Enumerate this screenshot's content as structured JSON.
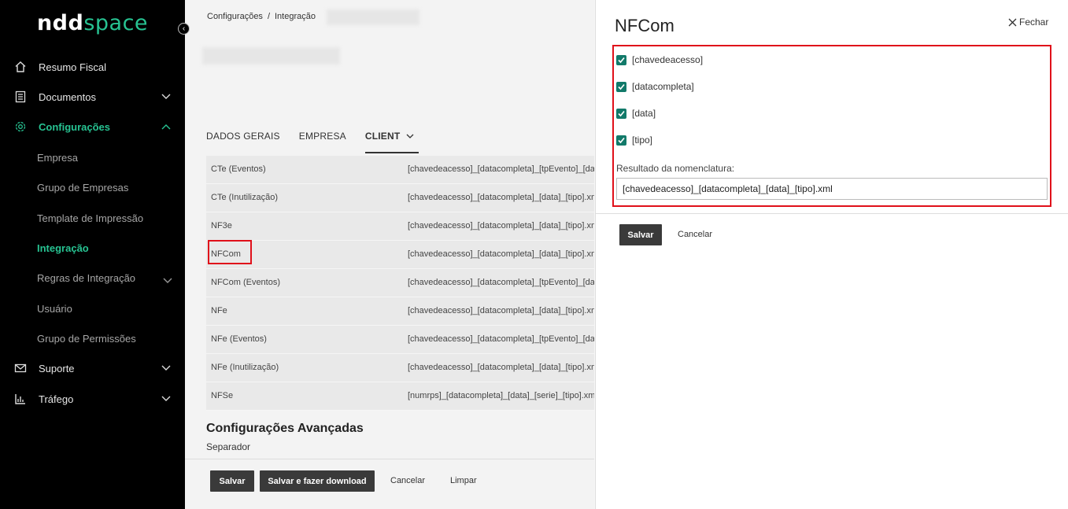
{
  "sidebar": {
    "logo_bold": "ndd",
    "logo_thin": "space",
    "items": [
      {
        "label": "Resumo Fiscal"
      },
      {
        "label": "Documentos"
      },
      {
        "label": "Configurações"
      },
      {
        "label": "Suporte"
      },
      {
        "label": "Tráfego"
      }
    ],
    "sub_items": [
      {
        "label": "Empresa"
      },
      {
        "label": "Grupo de Empresas"
      },
      {
        "label": "Template de Impressão"
      },
      {
        "label": "Integração"
      },
      {
        "label": "Regras de Integração"
      },
      {
        "label": "Usuário"
      },
      {
        "label": "Grupo de Permissões"
      }
    ]
  },
  "main": {
    "breadcrumb": {
      "first": "Configurações",
      "sep": "/",
      "second": "Integração"
    },
    "tabs": [
      {
        "label": "DADOS GERAIS"
      },
      {
        "label": "EMPRESA"
      },
      {
        "label": "CLIENT"
      }
    ],
    "rows": [
      {
        "name": "CTe (Eventos)",
        "pattern": "[chavedeacesso]_[datacompleta]_[tpEvento]_[dat"
      },
      {
        "name": "CTe (Inutilização)",
        "pattern": "[chavedeacesso]_[datacompleta]_[data]_[tipo].xm"
      },
      {
        "name": "NF3e",
        "pattern": "[chavedeacesso]_[datacompleta]_[data]_[tipo].xm"
      },
      {
        "name": "NFCom",
        "pattern": "[chavedeacesso]_[datacompleta]_[data]_[tipo].xm"
      },
      {
        "name": "NFCom (Eventos)",
        "pattern": "[chavedeacesso]_[datacompleta]_[tpEvento]_[dat"
      },
      {
        "name": "NFe",
        "pattern": "[chavedeacesso]_[datacompleta]_[data]_[tipo].xm"
      },
      {
        "name": "NFe (Eventos)",
        "pattern": "[chavedeacesso]_[datacompleta]_[tpEvento]_[dat"
      },
      {
        "name": "NFe (Inutilização)",
        "pattern": "[chavedeacesso]_[datacompleta]_[data]_[tipo].xm"
      },
      {
        "name": "NFSe",
        "pattern": "[numrps]_[datacompleta]_[data]_[serie]_[tipo].xm"
      }
    ],
    "advanced_title": "Configurações Avançadas",
    "advanced_sub": "Separador",
    "footer": {
      "save": "Salvar",
      "save_download": "Salvar e fazer download",
      "cancel": "Cancelar",
      "clear": "Limpar"
    }
  },
  "panel": {
    "title": "NFCom",
    "close_label": "Fechar",
    "checks": [
      {
        "label": "[chavedeacesso]",
        "checked": true
      },
      {
        "label": "[datacompleta]",
        "checked": true
      },
      {
        "label": "[data]",
        "checked": true
      },
      {
        "label": "[tipo]",
        "checked": true
      }
    ],
    "result_label": "Resultado da nomenclatura:",
    "result_value": "[chavedeacesso]_[datacompleta]_[data]_[tipo].xml",
    "save": "Salvar",
    "cancel": "Cancelar"
  },
  "colors": {
    "accent": "#27c392",
    "checkbox": "#127a6a",
    "highlight": "#e0101a"
  }
}
